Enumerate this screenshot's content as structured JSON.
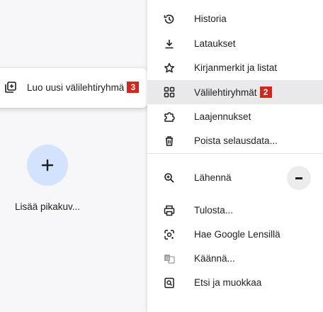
{
  "submenu": {
    "label": "Luo uusi välilehtiryhmä",
    "badge": "3",
    "icon": "add-tab-group-icon"
  },
  "shortcut": {
    "label": "Lisää pikakuv...",
    "icon": "plus-icon"
  },
  "menu": {
    "items": [
      {
        "label": "Historia",
        "icon": "history-icon"
      },
      {
        "label": "Lataukset",
        "icon": "download-icon"
      },
      {
        "label": "Kirjanmerkit ja listat",
        "icon": "star-icon"
      },
      {
        "label": "Välilehtiryhmät",
        "icon": "tab-groups-icon",
        "badge": "2"
      },
      {
        "label": "Laajennukset",
        "icon": "extension-icon"
      },
      {
        "label": "Poista selausdata...",
        "icon": "trash-icon"
      },
      {
        "label": "Lähennä",
        "icon": "zoom-icon"
      },
      {
        "label": "Tulosta...",
        "icon": "print-icon"
      },
      {
        "label": "Hae Google Lensillä",
        "icon": "lens-icon"
      },
      {
        "label": "Käännä...",
        "icon": "translate-icon"
      },
      {
        "label": "Etsi ja muokkaa",
        "icon": "find-icon"
      }
    ],
    "zoom_minus": "−"
  },
  "colors": {
    "badge": "#d1281b",
    "highlight": "#e9e9eb",
    "shortcut_bg": "#d3e3fd"
  }
}
